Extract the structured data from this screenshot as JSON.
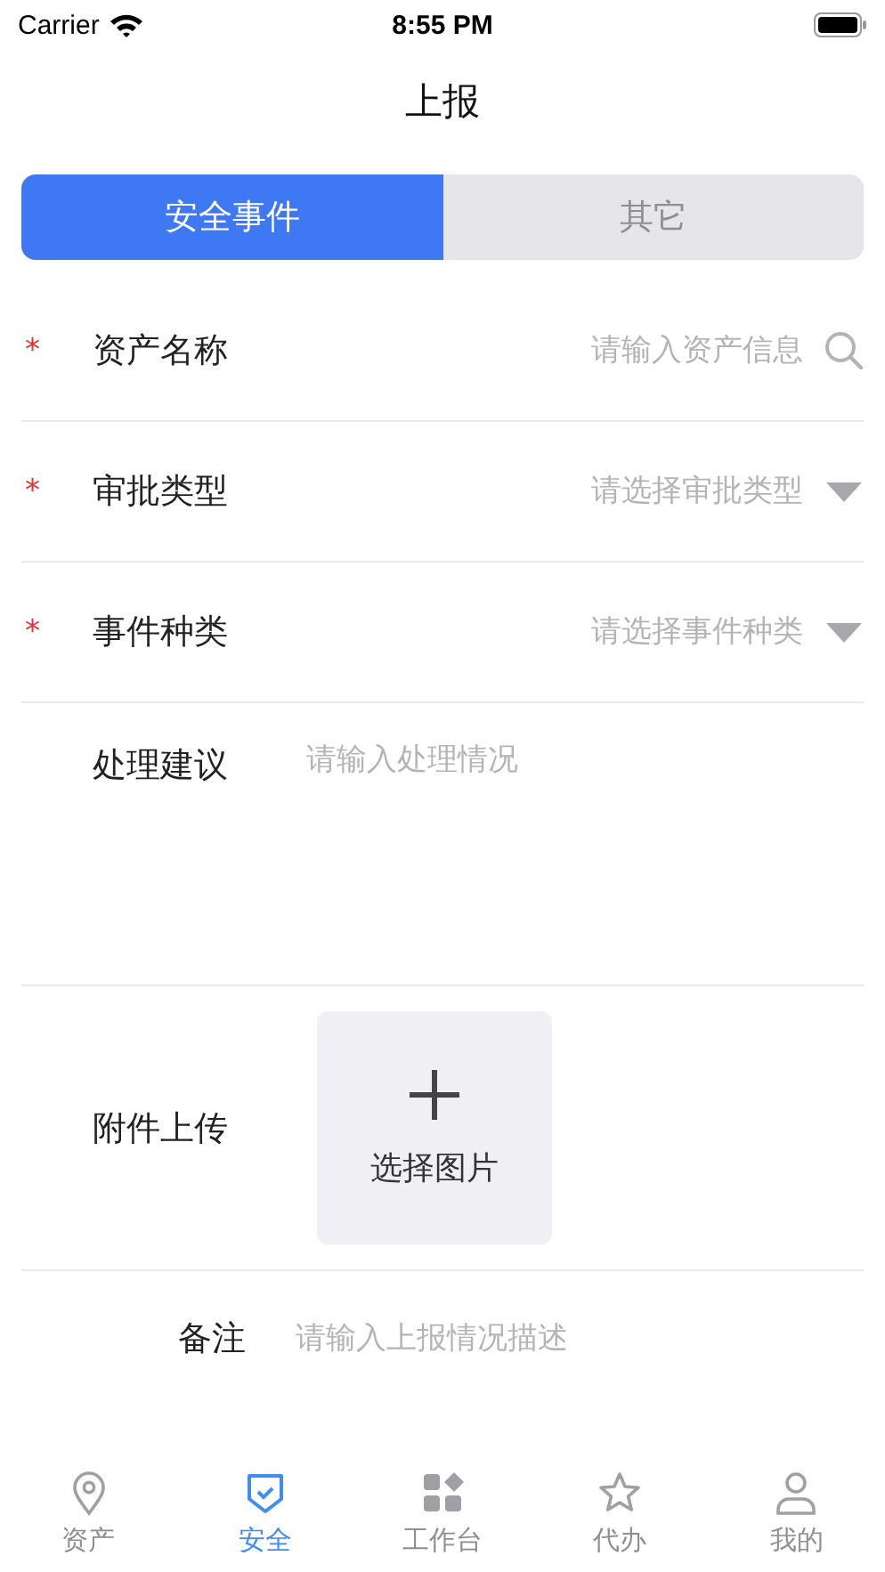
{
  "status_bar": {
    "carrier": "Carrier",
    "time": "8:55 PM"
  },
  "title": "上报",
  "segments": [
    {
      "label": "安全事件",
      "selected": true
    },
    {
      "label": "其它",
      "selected": false
    }
  ],
  "fields": [
    {
      "kind": "search",
      "label": "资产名称",
      "required_mark": "*",
      "placeholder": "请输入资产信息"
    },
    {
      "kind": "select",
      "label": "审批类型",
      "required_mark": "*",
      "placeholder": "请选择审批类型"
    },
    {
      "kind": "select",
      "label": "事件种类",
      "required_mark": "*",
      "placeholder": "请选择事件种类"
    },
    {
      "kind": "textarea",
      "label": "处理建议",
      "placeholder": "请输入处理情况"
    },
    {
      "kind": "upload",
      "label": "附件上传",
      "button": "选择图片"
    },
    {
      "kind": "note",
      "label": "备注",
      "placeholder": "请输入上报情况描述"
    }
  ],
  "tab_bar": [
    {
      "label": "资产",
      "selected": false
    },
    {
      "label": "安全",
      "selected": true
    },
    {
      "label": "工作台",
      "selected": false
    },
    {
      "label": "代办",
      "selected": false
    },
    {
      "label": "我的",
      "selected": false
    }
  ]
}
